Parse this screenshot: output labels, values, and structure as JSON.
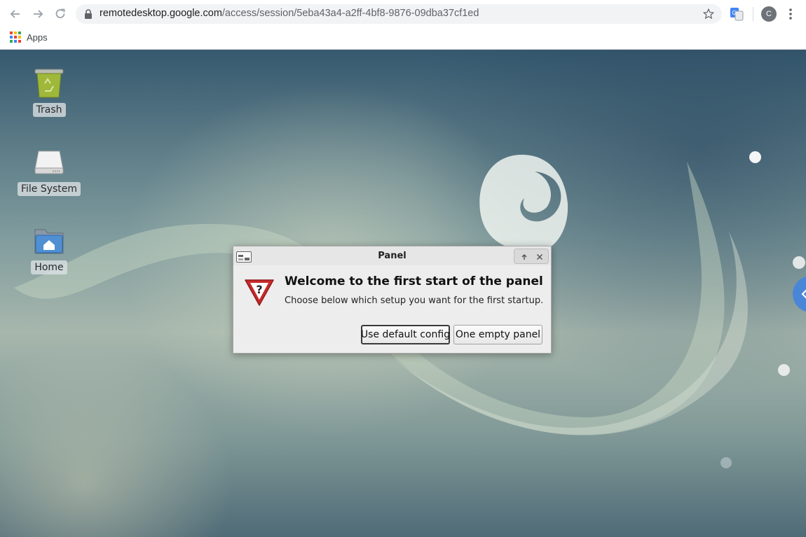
{
  "browser": {
    "url_host": "remotedesktop.google.com",
    "url_path": "/access/session/5eba43a4-a2ff-4bf8-9876-09dba37cf1ed",
    "profile_initial": "C",
    "bookmarks": {
      "apps_label": "Apps"
    }
  },
  "desktop": {
    "icons": [
      {
        "label": "Trash",
        "icon": "trash-icon"
      },
      {
        "label": "File System",
        "icon": "drive-icon"
      },
      {
        "label": "Home",
        "icon": "home-folder-icon"
      }
    ]
  },
  "dialog": {
    "title": "Panel",
    "headline": "Welcome to the first start of the panel",
    "message": "Choose below which setup you want for the first startup.",
    "buttons": {
      "default_config": "Use default config",
      "empty_panel": "One empty panel"
    }
  },
  "colors": {
    "accent_blue": "#4a86d8",
    "warning_red": "#c92a2a"
  }
}
